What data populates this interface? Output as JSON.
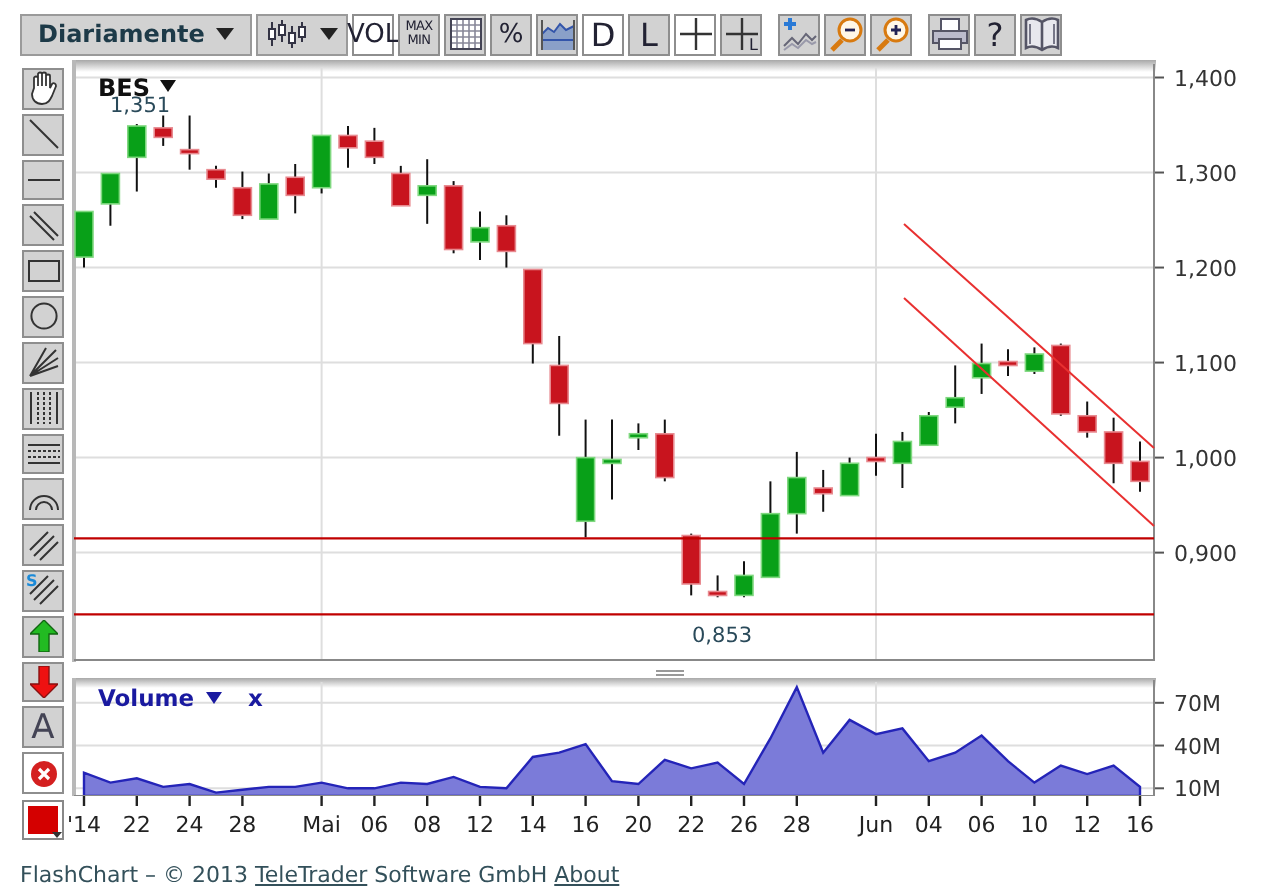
{
  "toolbar": {
    "period_dropdown": "Diariamente",
    "button_groups": [
      [
        {
          "kind": "chart-type-dropdown"
        },
        {
          "kind": "text",
          "label": "VOL",
          "on": true
        },
        {
          "kind": "text",
          "label": "MAX MIN",
          "on": false
        },
        {
          "kind": "grid",
          "on": false
        },
        {
          "kind": "text",
          "label": "%",
          "on": false
        },
        {
          "kind": "bands",
          "on": false
        },
        {
          "kind": "text",
          "label": "D",
          "on": true
        },
        {
          "kind": "text",
          "label": "L",
          "on": false
        },
        {
          "kind": "crosshair",
          "on": true
        },
        {
          "kind": "crosshair-label",
          "label": "L",
          "on": false
        }
      ],
      [
        {
          "kind": "add-indicator"
        },
        {
          "kind": "zoom-out"
        },
        {
          "kind": "zoom-in"
        }
      ],
      [
        {
          "kind": "print"
        },
        {
          "kind": "text",
          "label": "?"
        },
        {
          "kind": "book"
        }
      ]
    ]
  },
  "drawing_tools": [
    {
      "kind": "hand"
    },
    {
      "kind": "line"
    },
    {
      "kind": "horizontal-line"
    },
    {
      "kind": "parallel-lines"
    },
    {
      "kind": "rectangle"
    },
    {
      "kind": "ellipse"
    },
    {
      "kind": "fan"
    },
    {
      "kind": "vertical-grid"
    },
    {
      "kind": "horizontal-grid"
    },
    {
      "kind": "arcs"
    },
    {
      "kind": "channel"
    },
    {
      "kind": "channel-label",
      "label": "S"
    },
    {
      "kind": "arrow-up"
    },
    {
      "kind": "arrow-down"
    },
    {
      "kind": "text",
      "label": "A"
    },
    {
      "kind": "delete"
    },
    {
      "kind": "color"
    }
  ],
  "price_chart": {
    "symbol": "BES",
    "high_label": "1,351",
    "low_label": "0,853",
    "chart_data": {
      "type": "candlestick",
      "grid": true,
      "ylim": [
        0.787,
        1.41
      ],
      "categories": [
        "'14",
        null,
        "22",
        null,
        "24",
        null,
        "28",
        null,
        null,
        "Mai",
        null,
        "06",
        null,
        "08",
        null,
        "12",
        null,
        "14",
        null,
        "16",
        null,
        "20",
        null,
        "22",
        null,
        "26",
        null,
        "28",
        null,
        null,
        "Jun",
        null,
        "04",
        null,
        "06",
        null,
        "10",
        null,
        "12",
        null,
        "16"
      ],
      "ref_lines": [
        {
          "axis": "y",
          "value": 0.915
        },
        {
          "axis": "y",
          "value": 0.835
        }
      ],
      "ohlc": [
        [
          1.211,
          1.259,
          1.2,
          1.259
        ],
        [
          1.267,
          1.299,
          1.244,
          1.299
        ],
        [
          1.316,
          1.351,
          1.28,
          1.349
        ],
        [
          1.347,
          1.36,
          1.328,
          1.337
        ],
        [
          1.324,
          1.36,
          1.303,
          1.32
        ],
        [
          1.303,
          1.307,
          1.284,
          1.293
        ],
        [
          1.284,
          1.301,
          1.251,
          1.255
        ],
        [
          1.251,
          1.299,
          1.251,
          1.288
        ],
        [
          1.295,
          1.309,
          1.257,
          1.276
        ],
        [
          1.284,
          1.339,
          1.278,
          1.339
        ],
        [
          1.339,
          1.349,
          1.305,
          1.326
        ],
        [
          1.333,
          1.347,
          1.309,
          1.316
        ],
        [
          1.299,
          1.307,
          1.265,
          1.265
        ],
        [
          1.276,
          1.314,
          1.246,
          1.286
        ],
        [
          1.286,
          1.291,
          1.215,
          1.219
        ],
        [
          1.227,
          1.259,
          1.208,
          1.242
        ],
        [
          1.244,
          1.255,
          1.2,
          1.217
        ],
        [
          1.198,
          1.198,
          1.099,
          1.12
        ],
        [
          1.097,
          1.128,
          1.023,
          1.057
        ],
        [
          0.933,
          1.04,
          0.916,
          1.0
        ],
        [
          0.994,
          1.04,
          0.956,
          0.998
        ],
        [
          1.021,
          1.036,
          1.008,
          1.025
        ],
        [
          1.025,
          1.04,
          0.975,
          0.979
        ],
        [
          0.918,
          0.92,
          0.855,
          0.867
        ],
        [
          0.859,
          0.876,
          0.853,
          0.855
        ],
        [
          0.855,
          0.891,
          0.853,
          0.876
        ],
        [
          0.874,
          0.975,
          0.874,
          0.941
        ],
        [
          0.941,
          1.006,
          0.92,
          0.979
        ],
        [
          0.968,
          0.987,
          0.943,
          0.962
        ],
        [
          0.96,
          1.0,
          0.96,
          0.994
        ],
        [
          1.0,
          1.025,
          0.981,
          0.996
        ],
        [
          0.994,
          1.027,
          0.968,
          1.017
        ],
        [
          1.013,
          1.048,
          1.013,
          1.044
        ],
        [
          1.053,
          1.097,
          1.036,
          1.063
        ],
        [
          1.084,
          1.12,
          1.067,
          1.099
        ],
        [
          1.101,
          1.114,
          1.086,
          1.097
        ],
        [
          1.091,
          1.116,
          1.088,
          1.109
        ],
        [
          1.118,
          1.12,
          1.044,
          1.046
        ],
        [
          1.044,
          1.059,
          1.021,
          1.027
        ],
        [
          1.027,
          1.042,
          0.973,
          0.994
        ],
        [
          0.996,
          1.017,
          0.964,
          0.975
        ]
      ],
      "yticks": [
        {
          "value": 1.4,
          "label": "1,400"
        },
        {
          "value": 1.3,
          "label": "1,300"
        },
        {
          "value": 1.2,
          "label": "1,200"
        },
        {
          "value": 1.1,
          "label": "1,100"
        },
        {
          "value": 1.0,
          "label": "1,000"
        },
        {
          "value": 0.9,
          "label": "0,900"
        }
      ]
    }
  },
  "volume_chart": {
    "close": "x",
    "chart_data": {
      "type": "area",
      "grid": true,
      "ylim": [
        6,
        86
      ],
      "series": [
        {
          "name": "Volume",
          "color": "#7b7bd9",
          "values": [
            21,
            14,
            17,
            11,
            13,
            7,
            9,
            11,
            11,
            14,
            10,
            10,
            14,
            13,
            18,
            11,
            10,
            32,
            35,
            41,
            15,
            13,
            30,
            24,
            28,
            13,
            45,
            81,
            35,
            58,
            48,
            52,
            29,
            35,
            47,
            29,
            14,
            26,
            20,
            26,
            11
          ]
        }
      ],
      "yticks": [
        {
          "value": 70,
          "label": "70M"
        },
        {
          "value": 40,
          "label": "40M"
        },
        {
          "value": 10,
          "label": "10M"
        }
      ]
    }
  },
  "footer": {
    "text": "FlashChart – © 2013",
    "link": "TeleTrader",
    "text_after": "Software GmbH",
    "about": "About"
  }
}
